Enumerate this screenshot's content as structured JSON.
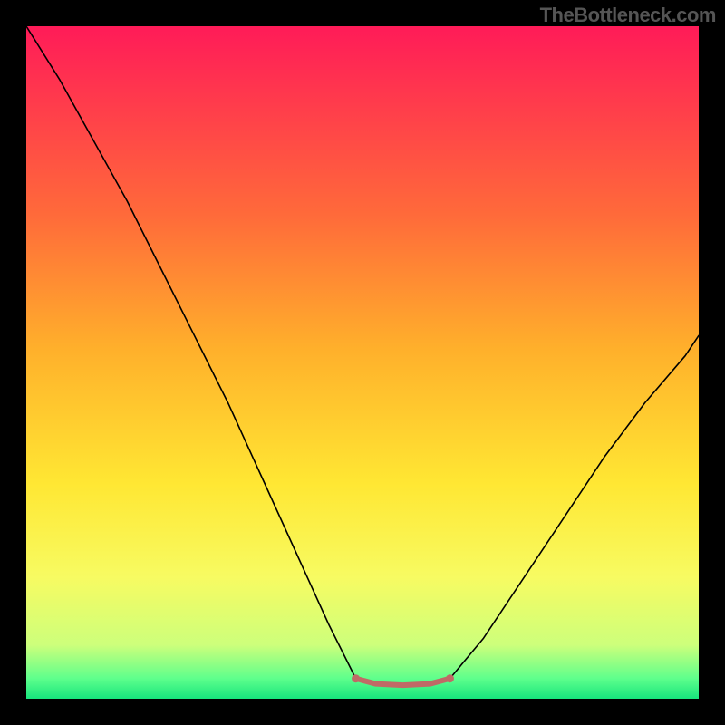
{
  "watermark": "TheBottleneck.com",
  "chart_data": {
    "type": "line",
    "title": "",
    "xlabel": "",
    "ylabel": "",
    "xlim": [
      0,
      100
    ],
    "ylim": [
      0,
      100
    ],
    "background_gradient_stops": [
      {
        "offset": 0,
        "color": "#ff1b58"
      },
      {
        "offset": 0.28,
        "color": "#ff6a3a"
      },
      {
        "offset": 0.48,
        "color": "#ffb02b"
      },
      {
        "offset": 0.68,
        "color": "#ffe733"
      },
      {
        "offset": 0.82,
        "color": "#f7fb62"
      },
      {
        "offset": 0.92,
        "color": "#cdff7b"
      },
      {
        "offset": 0.97,
        "color": "#5eff8c"
      },
      {
        "offset": 1.0,
        "color": "#17e57d"
      }
    ],
    "series": [
      {
        "name": "curve-left",
        "stroke": "#000000",
        "stroke_width": 1.6,
        "x": [
          0,
          5,
          10,
          15,
          20,
          25,
          30,
          35,
          40,
          45,
          49
        ],
        "y": [
          100,
          92,
          83,
          74,
          64,
          54,
          44,
          33,
          22,
          11,
          3
        ]
      },
      {
        "name": "flat-bottom",
        "stroke": "#c06a66",
        "stroke_width": 6,
        "x": [
          49,
          52,
          56,
          60,
          63
        ],
        "y": [
          3,
          2.2,
          2.0,
          2.2,
          3
        ]
      },
      {
        "name": "curve-right",
        "stroke": "#000000",
        "stroke_width": 1.6,
        "x": [
          63,
          68,
          74,
          80,
          86,
          92,
          98,
          100
        ],
        "y": [
          3,
          9,
          18,
          27,
          36,
          44,
          51,
          54
        ]
      }
    ],
    "markers": [
      {
        "x": 49,
        "y": 3,
        "r": 4.5,
        "fill": "#c06a66"
      },
      {
        "x": 63,
        "y": 3,
        "r": 4.5,
        "fill": "#c06a66"
      }
    ]
  }
}
